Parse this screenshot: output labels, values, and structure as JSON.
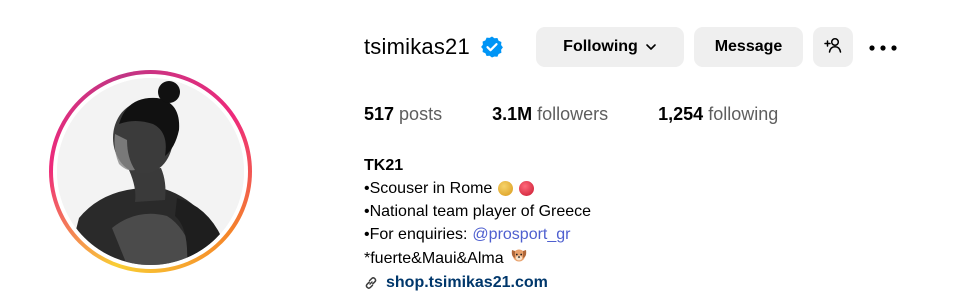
{
  "profile": {
    "username": "tsimikas21",
    "verified_icon": "verified-badge-icon",
    "following_label": "Following",
    "message_label": "Message",
    "add_user_icon": "person-plus-icon",
    "more_icon": "more-horizontal-icon"
  },
  "stats": {
    "posts_count": "517",
    "posts_label": "posts",
    "followers_count": "3.1M",
    "followers_label": "followers",
    "following_count": "1,254",
    "following_label": "following"
  },
  "bio": {
    "name": "TK21",
    "line1": "•Scouser in Rome",
    "line2": "•National team player of Greece",
    "line3_prefix": "•For enquiries:",
    "line3_mention": "@prosport_gr",
    "line4": "*fuerte&Maui&Alma",
    "link": "shop.tsimikas21.com"
  },
  "colors": {
    "accent_blue": "#0095f6",
    "mention": "#4e5fcf",
    "link": "#00376b",
    "button_bg": "#efefef",
    "rome_dot_1": "#e6b23a",
    "rome_dot_2": "#e3384e"
  }
}
